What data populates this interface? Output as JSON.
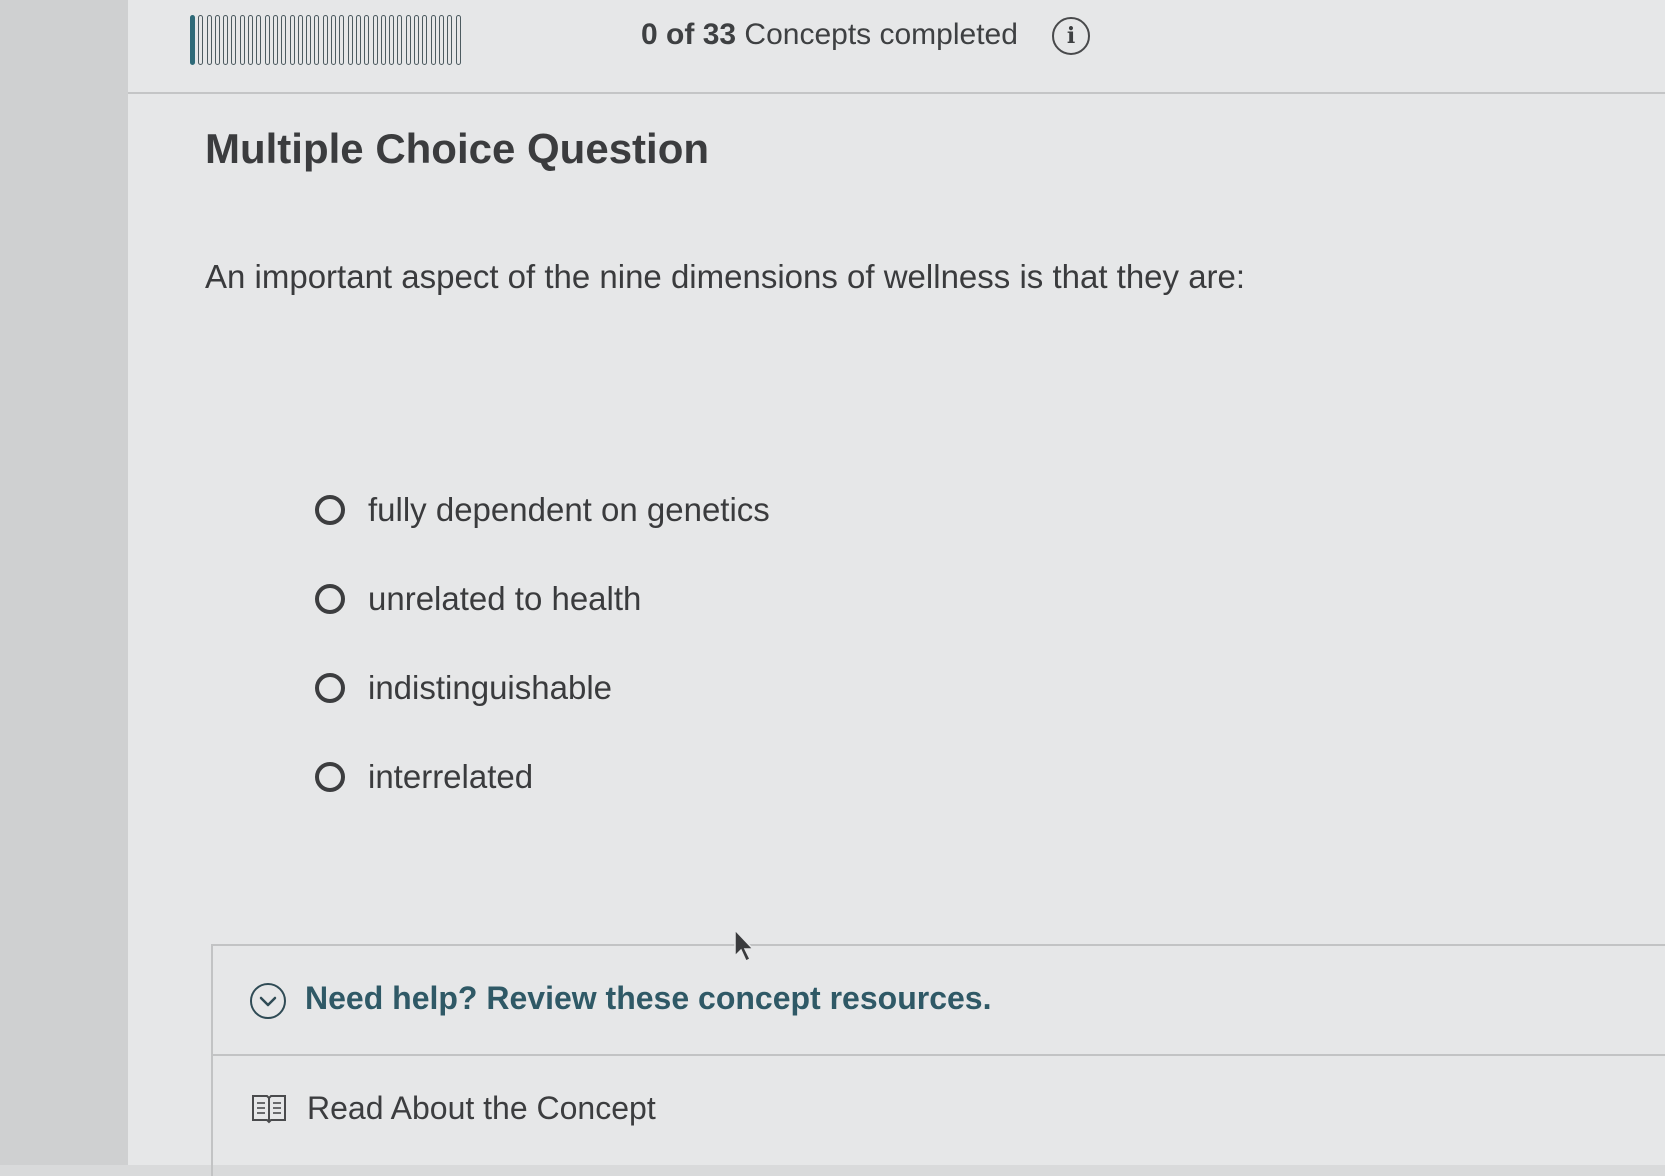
{
  "progress": {
    "completed": "0",
    "of_word": "of",
    "total": "33",
    "label": "Concepts completed",
    "completed_fraction": 0,
    "segment_count": 33,
    "filled_segments": 1
  },
  "info_icon": {
    "glyph": "i",
    "icon": "info-icon"
  },
  "question": {
    "type_label": "Multiple Choice Question",
    "text": "An important aspect of the nine dimensions of wellness is that they are:",
    "options": [
      {
        "label": "fully dependent on genetics",
        "selected": false
      },
      {
        "label": "unrelated to health",
        "selected": false
      },
      {
        "label": "indistinguishable",
        "selected": false
      },
      {
        "label": "interrelated",
        "selected": false
      }
    ]
  },
  "help": {
    "title": "Need help? Review these concept resources.",
    "toggle_icon": "chevron-down-icon",
    "resources": [
      {
        "label": "Read About the Concept",
        "icon": "book-icon"
      }
    ]
  },
  "colors": {
    "accent": "#2f6a78",
    "help_text": "#2f5966",
    "panel_bg": "#e6e7e8",
    "body_text": "#3a3b3d"
  }
}
